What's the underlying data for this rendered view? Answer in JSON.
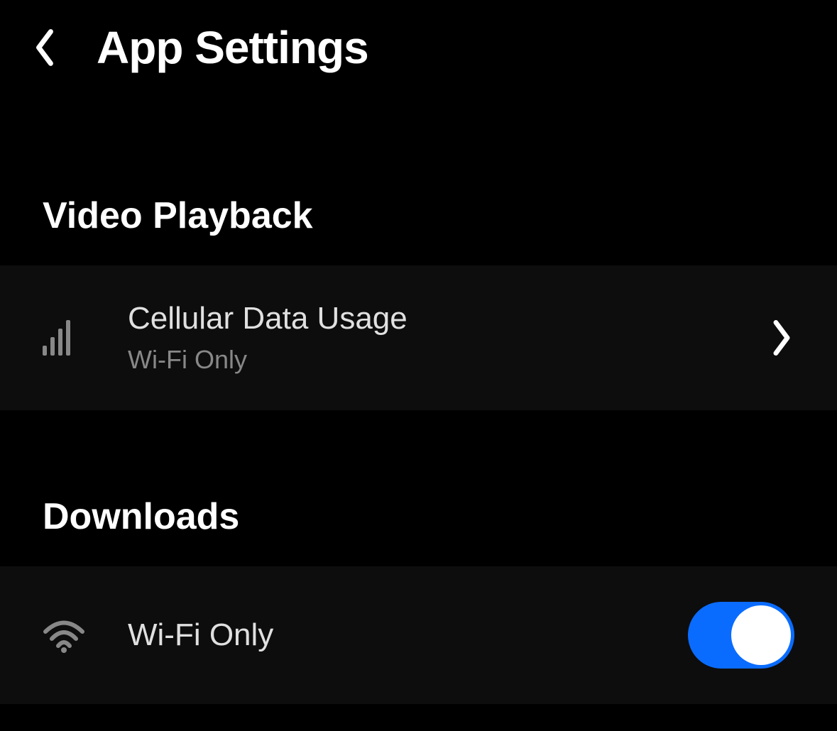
{
  "header": {
    "title": "App Settings"
  },
  "sections": {
    "video_playback": {
      "title": "Video Playback",
      "cellular_data": {
        "label": "Cellular Data Usage",
        "value": "Wi-Fi Only"
      }
    },
    "downloads": {
      "title": "Downloads",
      "wifi_only": {
        "label": "Wi-Fi Only",
        "enabled": true
      }
    }
  },
  "colors": {
    "accent": "#0a6cff",
    "background": "#000000",
    "row_background": "#0d0d0d"
  }
}
